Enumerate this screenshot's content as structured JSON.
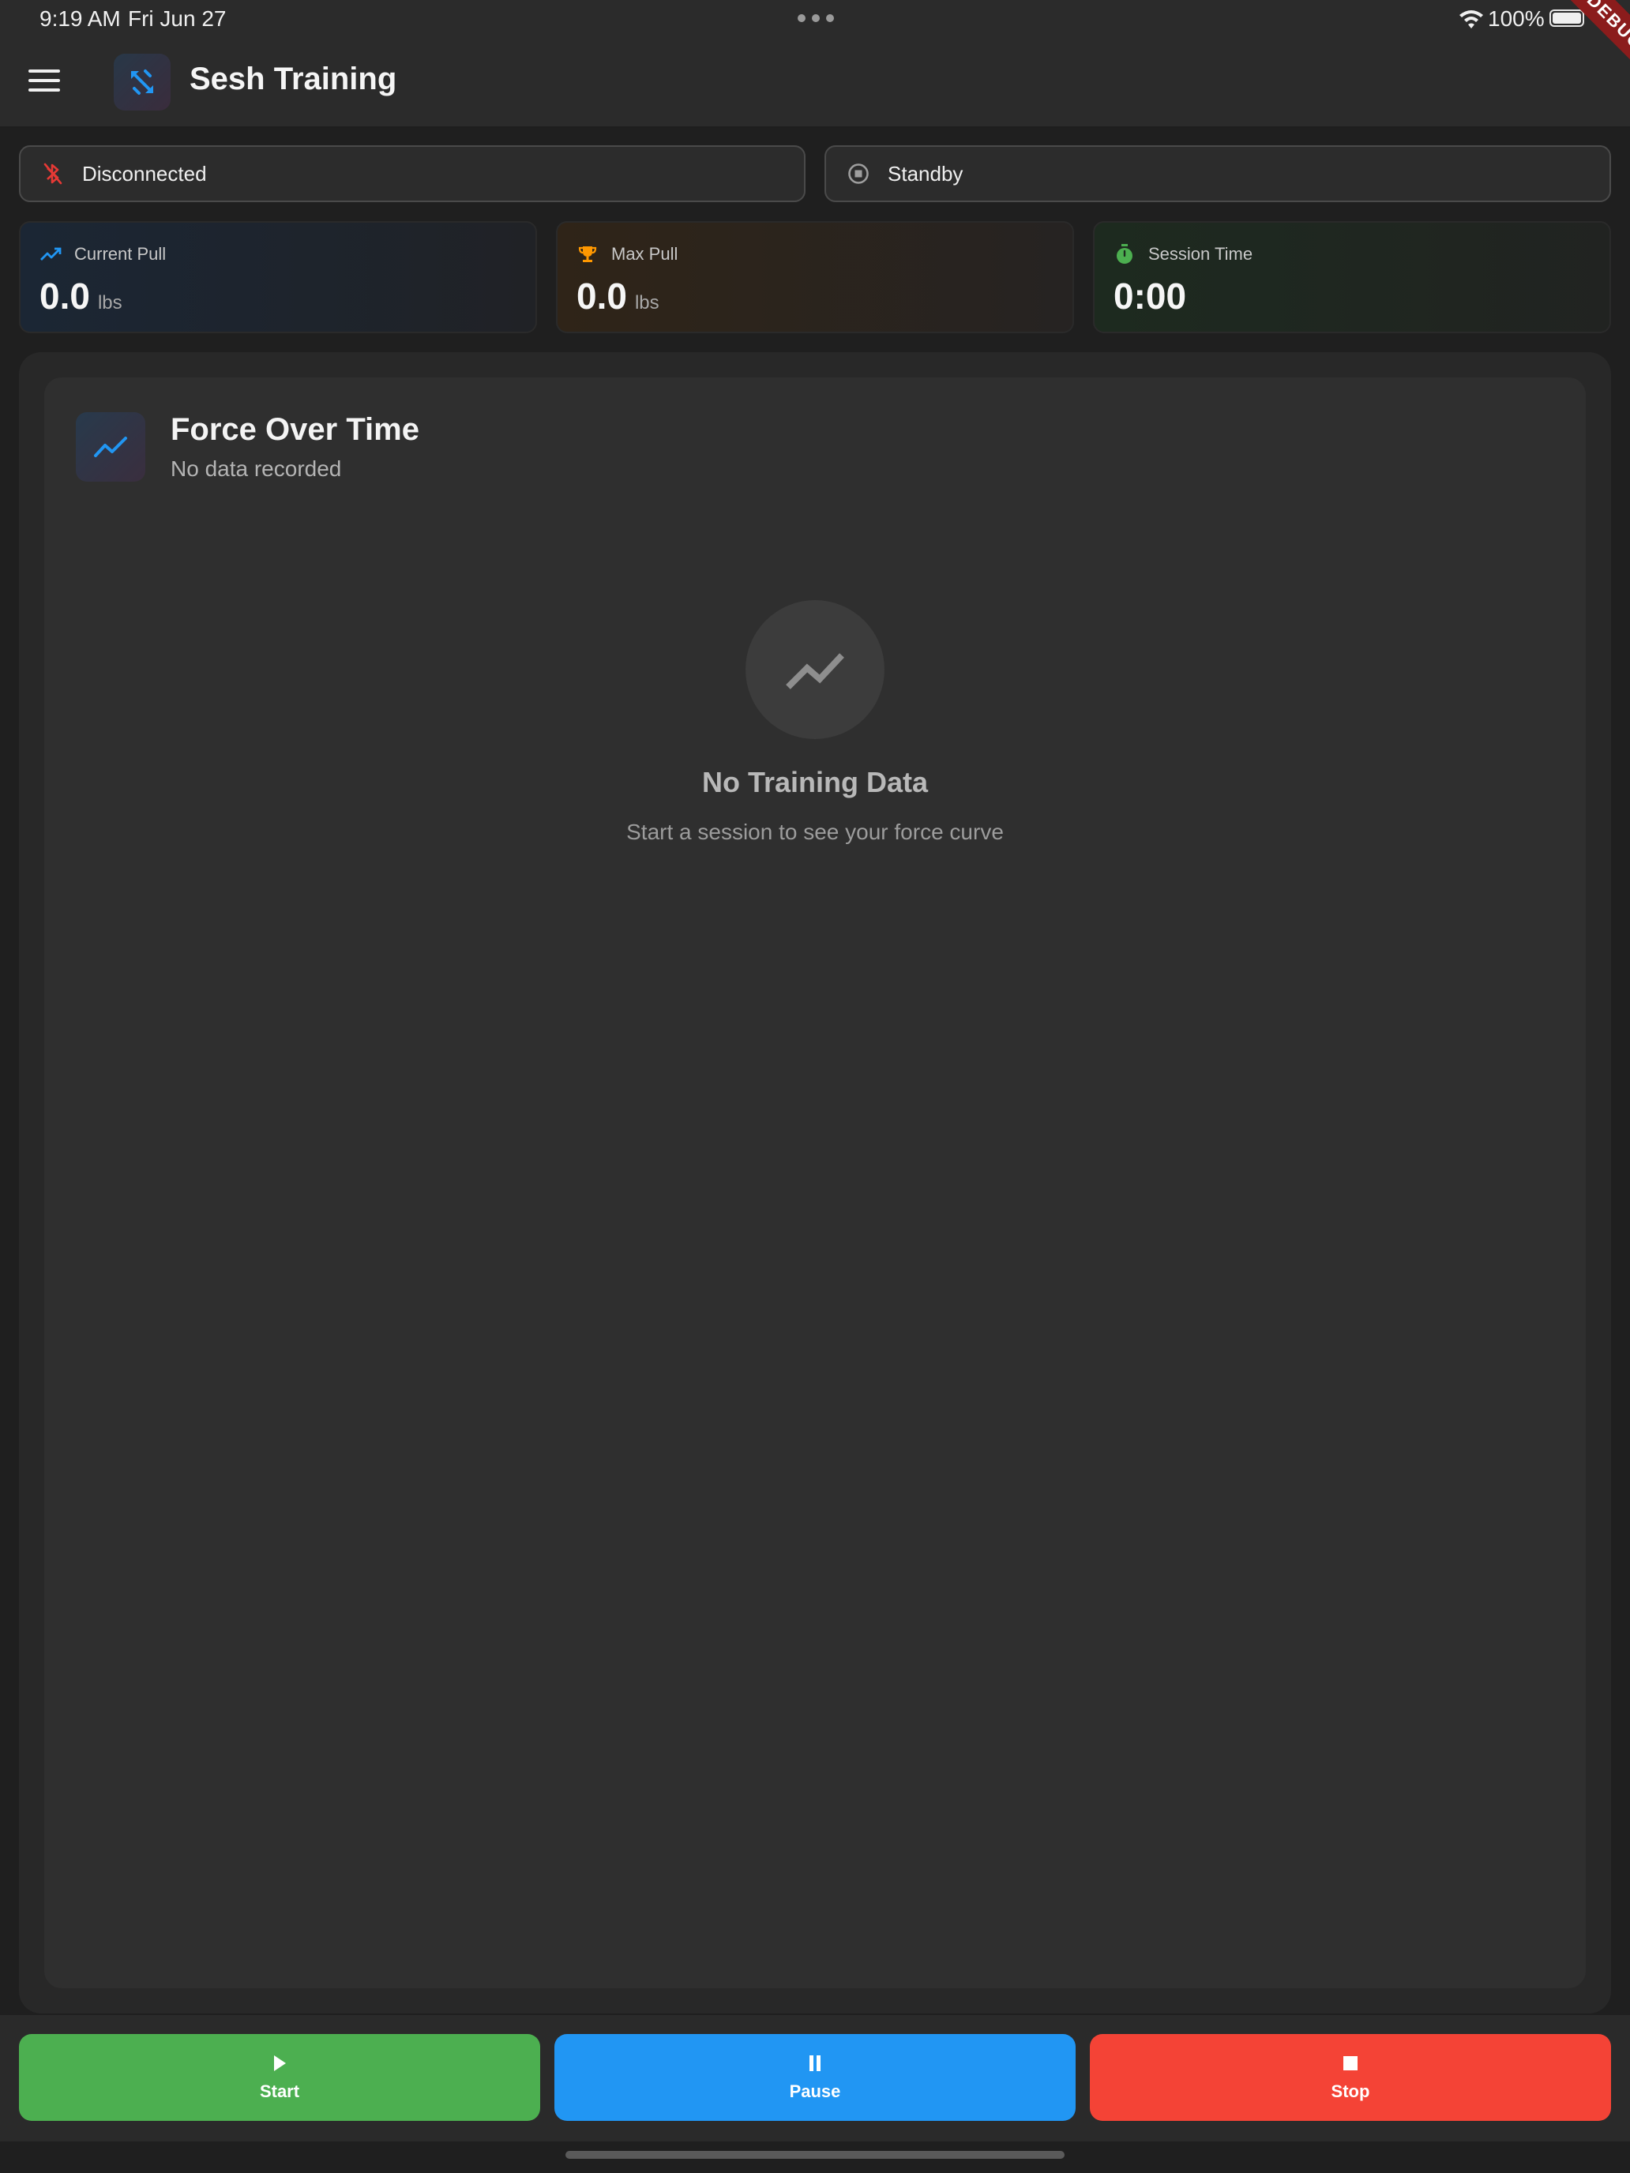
{
  "status_bar": {
    "time": "9:19 AM",
    "date": "Fri Jun 27",
    "battery": "100%"
  },
  "debug_banner": "DEBUG",
  "app_bar": {
    "title": "Sesh Training",
    "logo_icon": "fitness-arrows-icon"
  },
  "status": {
    "connection": "Disconnected",
    "connection_icon": "bluetooth-disabled-icon",
    "session_state": "Standby",
    "session_state_icon": "stop-circle-icon"
  },
  "stats": {
    "current_pull": {
      "label": "Current Pull",
      "value": "0.0",
      "unit": "lbs",
      "icon": "trending-up-icon",
      "color": "#2196f3"
    },
    "max_pull": {
      "label": "Max Pull",
      "value": "0.0",
      "unit": "lbs",
      "icon": "trophy-icon",
      "color": "#ff9800"
    },
    "session_time": {
      "label": "Session Time",
      "value": "0:00",
      "icon": "timer-icon",
      "color": "#4caf50"
    }
  },
  "chart_card": {
    "title": "Force Over Time",
    "subtitle": "No data recorded",
    "empty_title": "No Training Data",
    "empty_subtitle": "Start a session to see your force curve"
  },
  "controls": {
    "start_label": "Start",
    "pause_label": "Pause",
    "stop_label": "Stop"
  },
  "colors": {
    "start": "#4caf50",
    "pause": "#2196f3",
    "stop": "#f44336",
    "disconnected": "#e53935"
  }
}
